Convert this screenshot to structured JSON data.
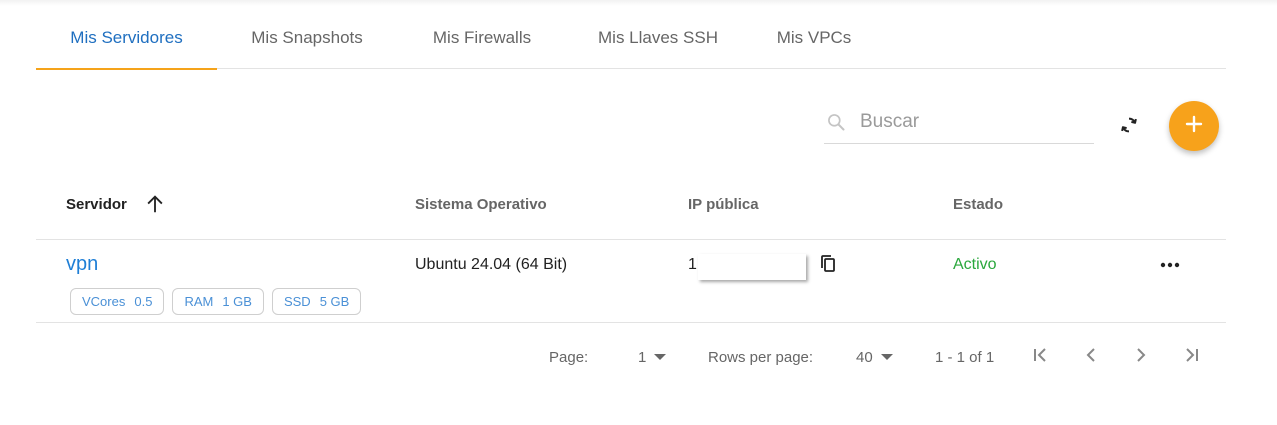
{
  "tabs": [
    {
      "label": "Mis Servidores",
      "active": true
    },
    {
      "label": "Mis Snapshots",
      "active": false
    },
    {
      "label": "Mis Firewalls",
      "active": false
    },
    {
      "label": "Mis Llaves SSH",
      "active": false
    },
    {
      "label": "Mis VPCs",
      "active": false
    }
  ],
  "toolbar": {
    "search_placeholder": "Buscar",
    "search_value": "",
    "icons": {
      "search": "search-icon",
      "refresh": "refresh-icon",
      "add": "plus-icon"
    }
  },
  "table": {
    "headers": {
      "server": "Servidor",
      "os": "Sistema Operativo",
      "ip": "IP pública",
      "state": "Estado"
    },
    "sort": {
      "column": "server",
      "direction": "asc"
    },
    "rows": [
      {
        "name": "vpn",
        "specs": [
          {
            "label": "VCores",
            "value": "0.5"
          },
          {
            "label": "RAM",
            "value": "1 GB"
          },
          {
            "label": "SSD",
            "value": "5 GB"
          }
        ],
        "os": "Ubuntu 24.04 (64 Bit)",
        "ip": "1",
        "status": "Activo"
      }
    ]
  },
  "pagination": {
    "page_label": "Page:",
    "page_value": "1",
    "rows_label": "Rows per page:",
    "rows_value": "40",
    "range": "1 - 1 of 1"
  },
  "colors": {
    "accent": "#f7a21b",
    "active_tab": "#1f6fc0",
    "link": "#1f7fd6",
    "status_active": "#2aa73c"
  }
}
